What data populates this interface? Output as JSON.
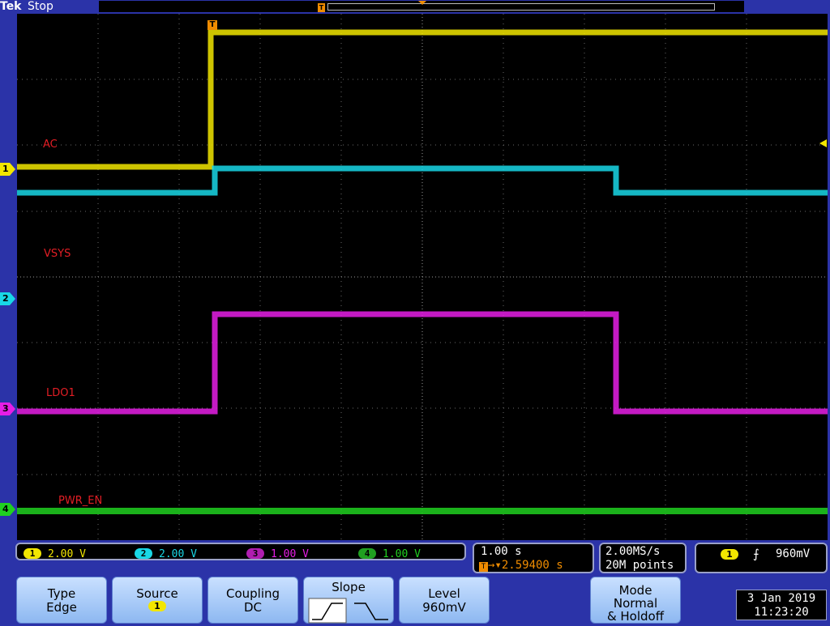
{
  "header": {
    "brand": "Tek",
    "status": "Stop"
  },
  "trace_labels": {
    "ch1": "AC",
    "ch2": "VSYS",
    "ch3": "LDO1",
    "ch4": "PWR_EN"
  },
  "markers": {
    "ch1": "1",
    "ch2": "2",
    "ch3": "3",
    "ch4": "4",
    "trigger": "T"
  },
  "colors": {
    "ch1": "#f2e600",
    "ch2": "#19d7e6",
    "ch3": "#e61ee6",
    "ch4": "#20d020",
    "label": "#e41e25",
    "trigger": "#f08c00"
  },
  "channels": [
    {
      "num": "1",
      "scale": "2.00 V"
    },
    {
      "num": "2",
      "scale": "2.00 V"
    },
    {
      "num": "3",
      "scale": "1.00 V"
    },
    {
      "num": "4",
      "scale": "1.00 V"
    }
  ],
  "timebase": {
    "scale": "1.00 s",
    "trigger_pos": "2.59400 s"
  },
  "acquisition": {
    "rate": "2.00MS/s",
    "length": "20M points"
  },
  "trigger": {
    "source": "1",
    "level": "960mV"
  },
  "buttons": {
    "type": {
      "label": "Type",
      "value": "Edge"
    },
    "source": {
      "label": "Source",
      "value": "1"
    },
    "coupling": {
      "label": "Coupling",
      "value": "DC"
    },
    "slope": {
      "label": "Slope"
    },
    "level": {
      "label": "Level",
      "value": "960mV"
    },
    "mode": {
      "label": "Mode",
      "value1": "Normal",
      "value2": "& Holdoff"
    }
  },
  "datetime": {
    "date": "3 Jan  2019",
    "time": "11:23:20"
  }
}
